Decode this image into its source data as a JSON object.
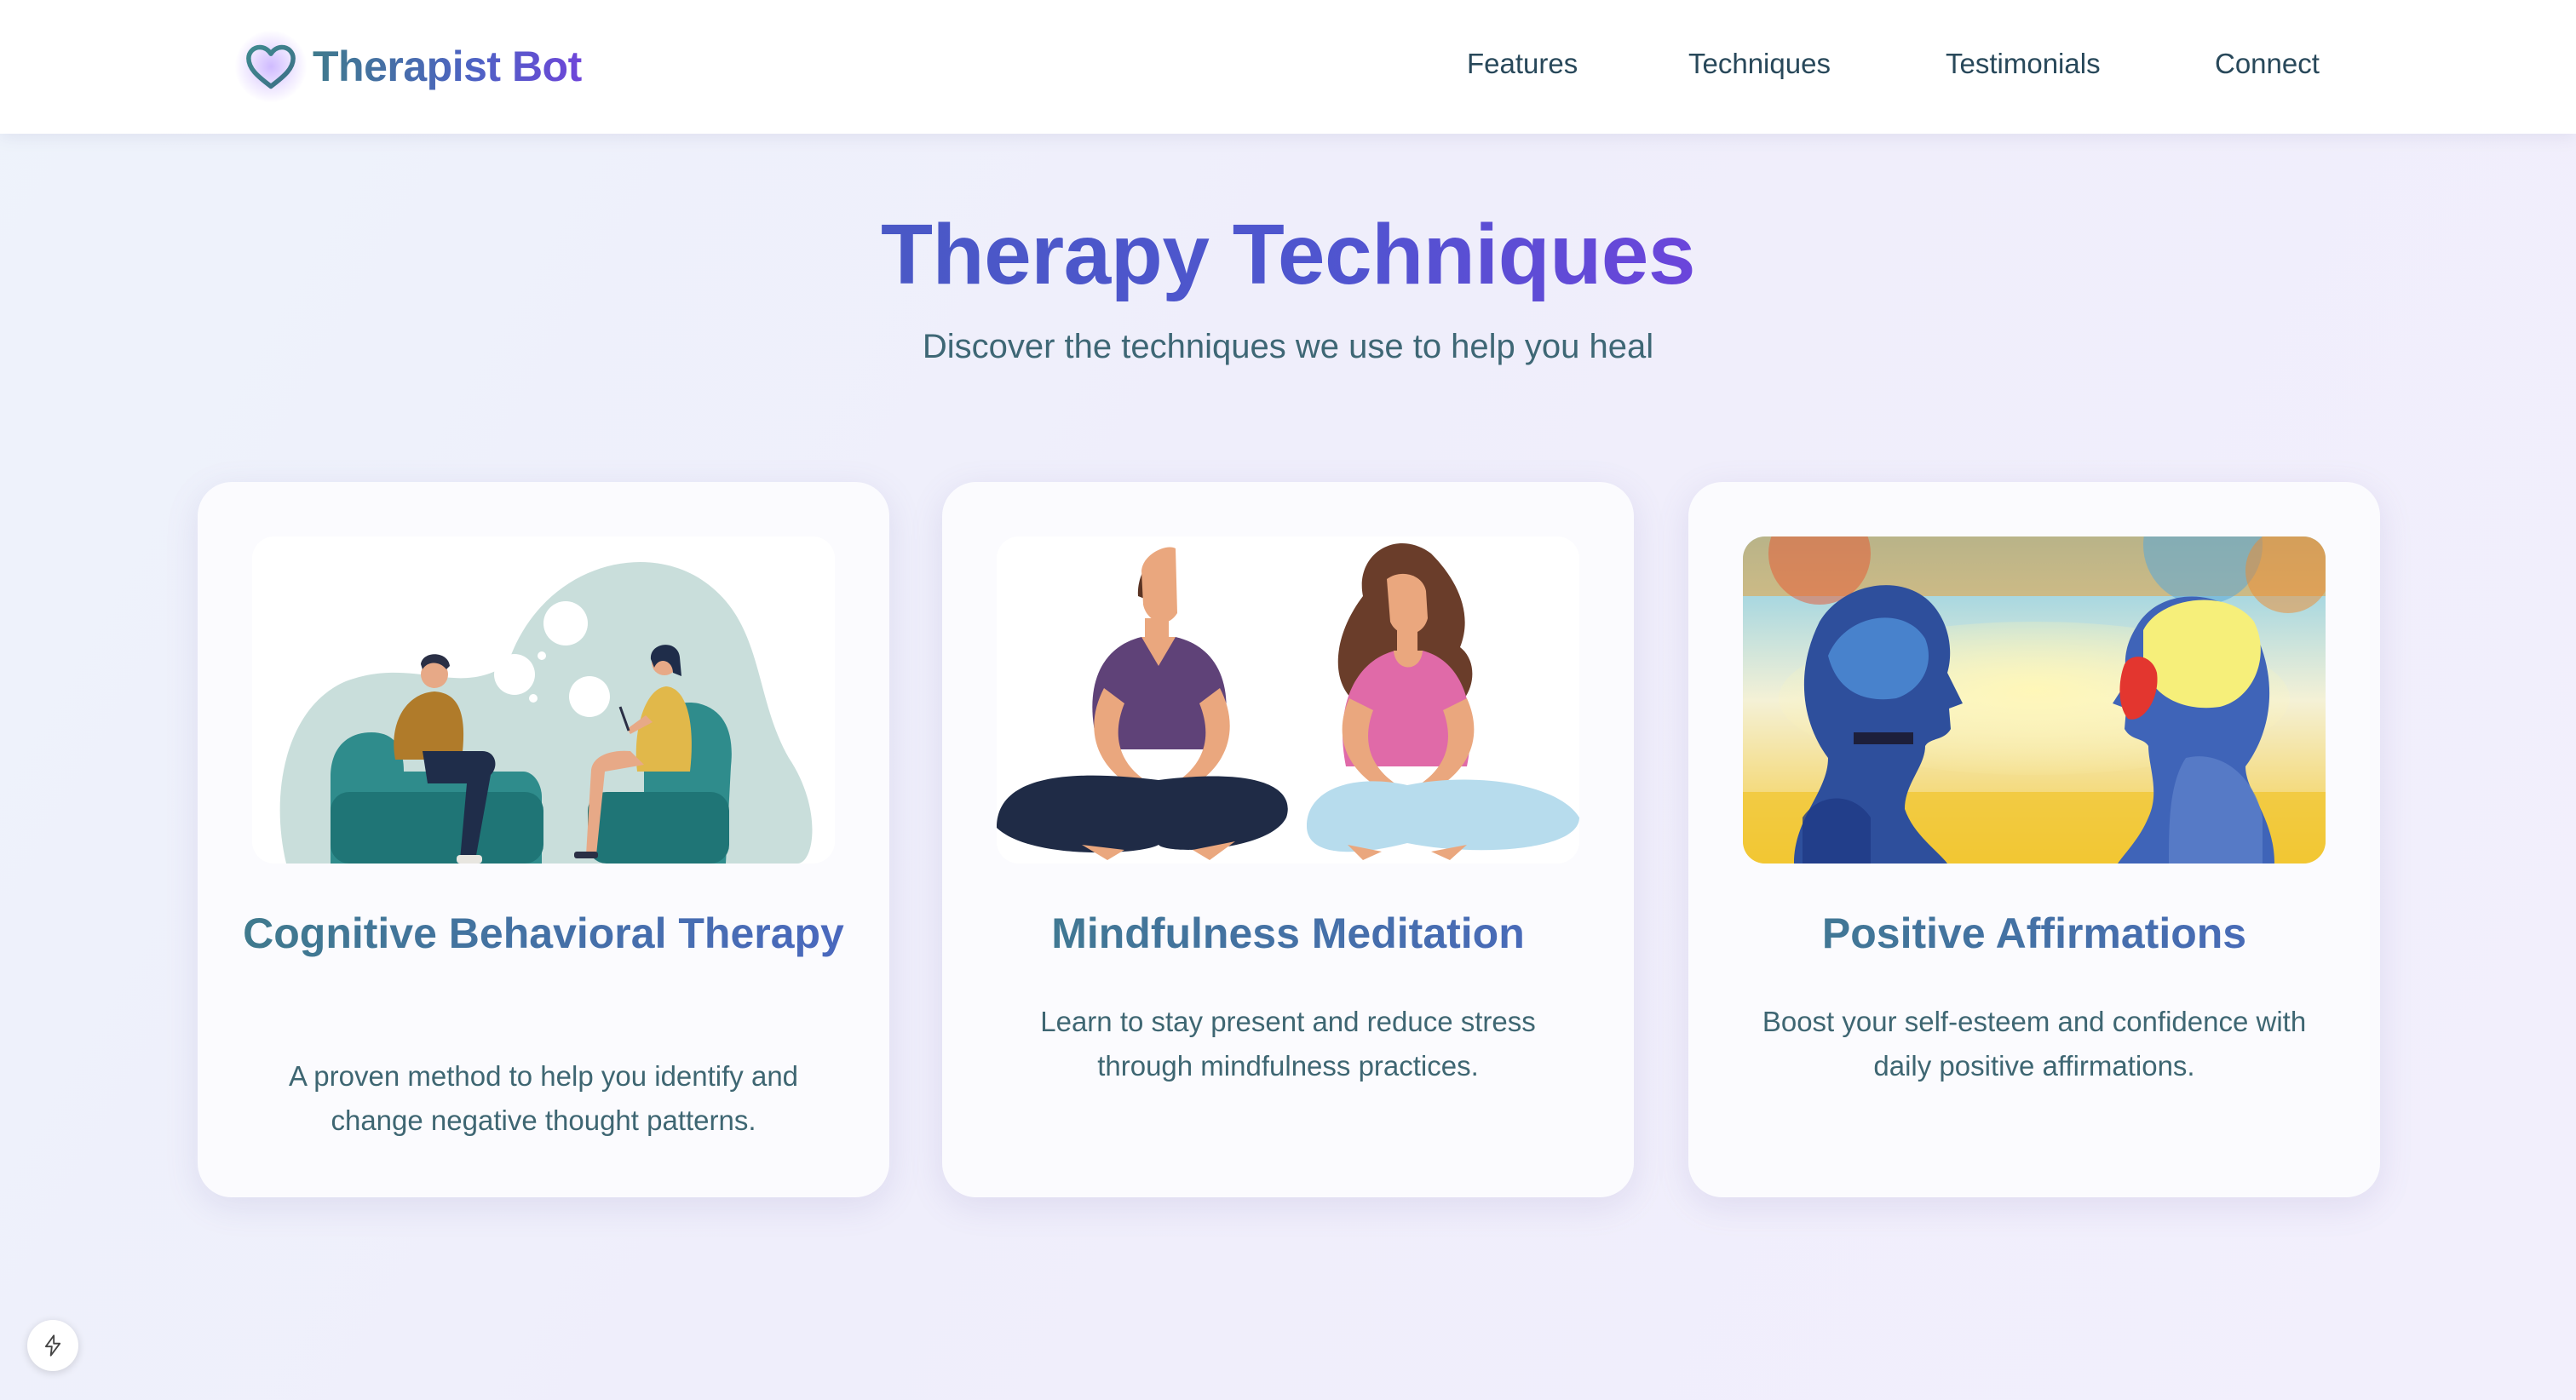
{
  "brand": {
    "name": "Therapist Bot",
    "icon": "heart-icon"
  },
  "nav": {
    "links": [
      {
        "label": "Features"
      },
      {
        "label": "Techniques"
      },
      {
        "label": "Testimonials"
      },
      {
        "label": "Connect"
      }
    ]
  },
  "hero": {
    "title": "Therapy Techniques",
    "subtitle": "Discover the techniques we use to help you heal"
  },
  "cards": [
    {
      "title": "Cognitive Behavioral Therapy",
      "description": "A proven method to help you identify and change negative thought patterns.",
      "image": "therapy-session-illustration"
    },
    {
      "title": "Mindfulness Meditation",
      "description": "Learn to stay present and reduce stress through mindfulness practices.",
      "image": "meditating-couple-illustration"
    },
    {
      "title": "Positive Affirmations",
      "description": "Boost your self-esteem and confidence with daily positive affirmations.",
      "image": "watercolor-heads-painting"
    }
  ],
  "floating_badge": {
    "icon": "lightning-icon"
  },
  "colors": {
    "brand_gradient_start": "#3f7a8c",
    "brand_gradient_end": "#6e45d9",
    "hero_title": "#4f55cf",
    "body_text": "#3e6672",
    "nav_text": "#28485a"
  }
}
